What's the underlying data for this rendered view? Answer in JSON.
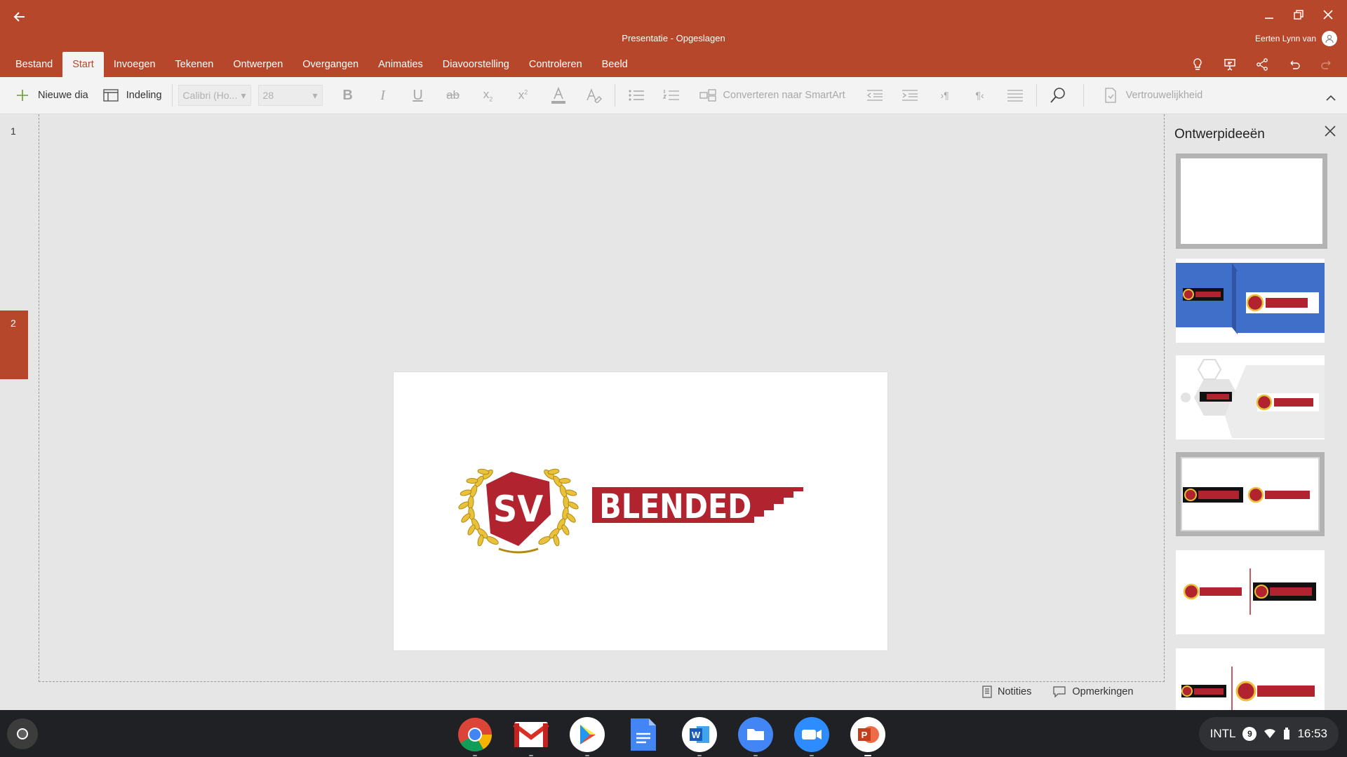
{
  "window": {
    "title": "Presentatie - Opgeslagen",
    "user_name": "Eerten Lynn van"
  },
  "menu_tabs": [
    "Bestand",
    "Start",
    "Invoegen",
    "Tekenen",
    "Ontwerpen",
    "Overgangen",
    "Animaties",
    "Diavoorstelling",
    "Controleren",
    "Beeld"
  ],
  "active_tab": "Start",
  "ribbon": {
    "new_slide": "Nieuwe dia",
    "layout": "Indeling",
    "font_name": "Calibri (Ho...",
    "font_size": "28",
    "bold": "B",
    "italic": "I",
    "underline": "U",
    "strikethrough": "ab",
    "subscript": "x",
    "superscript": "x",
    "subscript_mark": "2",
    "superscript_mark": "2",
    "convert_smartart": "Converteren naar SmartArt",
    "sensitivity": "Vertrouwelijkheid"
  },
  "slides": [
    {
      "number": "1"
    },
    {
      "number": "2",
      "selected": true
    }
  ],
  "slide_content": {
    "logo_initials": "SV",
    "logo_word": "BLENDED"
  },
  "status": {
    "notes": "Notities",
    "comments": "Opmerkingen"
  },
  "design_pane": {
    "title": "Ontwerpideeën",
    "selected_index": 3,
    "card_count": 6
  },
  "taskbar": {
    "apps": [
      "chrome-icon",
      "gmail-icon",
      "play-store-icon",
      "docs-icon",
      "word-icon",
      "files-icon",
      "zoom-icon",
      "powerpoint-icon"
    ],
    "keyboard": "INTL",
    "notification_count": "9",
    "time": "16:53"
  },
  "colors": {
    "accent": "#b7472a",
    "logo_red": "#b0232f",
    "laurel_gold": "#e9c13a"
  }
}
